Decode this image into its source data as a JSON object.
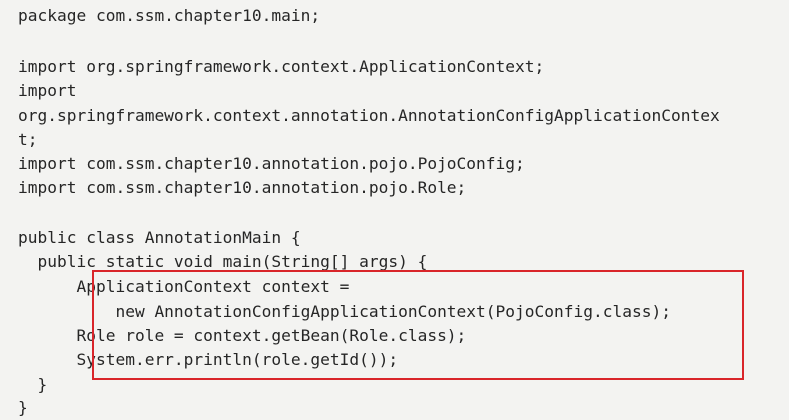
{
  "code": {
    "lines": [
      "package com.ssm.chapter10.main;",
      "",
      "import org.springframework.context.ApplicationContext;",
      "import",
      "org.springframework.context.annotation.AnnotationConfigApplicationContex",
      "t;",
      "import com.ssm.chapter10.annotation.pojo.PojoConfig;",
      "import com.ssm.chapter10.annotation.pojo.Role;",
      "",
      "public class AnnotationMain {",
      "  public static void main(String[] args) {",
      "      ApplicationContext context =",
      "          new AnnotationConfigApplicationContext(PojoConfig.class);",
      "      Role role = context.getBean(Role.class);",
      "      System.err.println(role.getId());",
      "  }",
      "}"
    ]
  },
  "highlight": {
    "border_color": "#d9252a"
  }
}
